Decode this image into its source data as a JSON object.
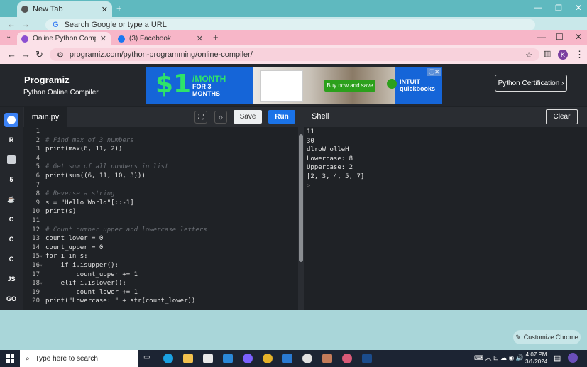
{
  "outer_browser": {
    "tab_title": "New Tab",
    "omnibox_placeholder": "Search Google or type a URL"
  },
  "browser": {
    "tabs": [
      {
        "title": "Online Python Compiler (Interp",
        "active": true,
        "favicon_color": "#8c4fd1"
      },
      {
        "title": "(3) Facebook",
        "active": false,
        "favicon_color": "#1877f2"
      }
    ],
    "url": "programiz.com/python-programming/online-compiler/",
    "profile_initial": "K"
  },
  "site": {
    "logo": "Programiz",
    "subtitle": "Python Online Compiler",
    "certification_button": "Python Certification ›"
  },
  "ad": {
    "price": "$1",
    "per": "/MONTH",
    "for_line1": "FOR 3",
    "for_line2": "MONTHS",
    "cta": "Buy now and save",
    "brand_line1": "INTUIT",
    "brand_line2": "quickbooks"
  },
  "sidebar": {
    "items": [
      {
        "name": "python",
        "label": ""
      },
      {
        "name": "r",
        "label": "R"
      },
      {
        "name": "sql",
        "label": ""
      },
      {
        "name": "html",
        "label": "5"
      },
      {
        "name": "java",
        "label": ""
      },
      {
        "name": "c",
        "label": "C"
      },
      {
        "name": "cpp",
        "label": "C"
      },
      {
        "name": "csharp",
        "label": "C"
      },
      {
        "name": "js",
        "label": "JS"
      },
      {
        "name": "go",
        "label": "GO"
      }
    ]
  },
  "editor": {
    "filename": "main.py",
    "save_label": "Save",
    "run_label": "Run",
    "lines": [
      {
        "n": "1",
        "fold": "",
        "code": ""
      },
      {
        "n": "2",
        "fold": "",
        "code": "# Find max of 3 numbers"
      },
      {
        "n": "3",
        "fold": "",
        "code": "print(max(6, 11, 2))"
      },
      {
        "n": "4",
        "fold": "",
        "code": ""
      },
      {
        "n": "5",
        "fold": "",
        "code": "# Get sum of all numbers in list"
      },
      {
        "n": "6",
        "fold": "",
        "code": "print(sum((6, 11, 10, 3)))"
      },
      {
        "n": "7",
        "fold": "",
        "code": ""
      },
      {
        "n": "8",
        "fold": "",
        "code": "# Reverse a string"
      },
      {
        "n": "9",
        "fold": "",
        "code": "s = \"Hello World\"[::-1]"
      },
      {
        "n": "10",
        "fold": "",
        "code": "print(s)"
      },
      {
        "n": "11",
        "fold": "",
        "code": ""
      },
      {
        "n": "12",
        "fold": "",
        "code": "# Count number upper and lowercase letters"
      },
      {
        "n": "13",
        "fold": "",
        "code": "count_lower = 0"
      },
      {
        "n": "14",
        "fold": "",
        "code": "count_upper = 0"
      },
      {
        "n": "15",
        "fold": "▾",
        "code": "for i in s:"
      },
      {
        "n": "16",
        "fold": "▾",
        "code": "    if i.isupper():"
      },
      {
        "n": "17",
        "fold": "",
        "code": "        count_upper += 1"
      },
      {
        "n": "18",
        "fold": "▾",
        "code": "    elif i.islower():"
      },
      {
        "n": "19",
        "fold": "",
        "code": "        count_lower += 1"
      },
      {
        "n": "20",
        "fold": "",
        "code": "print(\"Lowercase: \" + str(count_lower))"
      }
    ]
  },
  "shell": {
    "title": "Shell",
    "clear_label": "Clear",
    "output": [
      "11",
      "30",
      "dlroW olleH",
      "Lowercase: 8",
      "Uppercase: 2",
      "[2, 3, 4, 5, 7]"
    ],
    "prompt": ">"
  },
  "customize_chrome": "Customize Chrome",
  "taskbar": {
    "search_placeholder": "Type here to search",
    "time": "4:07 PM",
    "date": "3/1/2024"
  },
  "colors": {
    "comment": "#6b6f75",
    "keyword": "#d0a0ff",
    "function": "#f0c674",
    "number": "#ff6b6b",
    "string": "#f5a97f",
    "run": "#1a73e8"
  }
}
